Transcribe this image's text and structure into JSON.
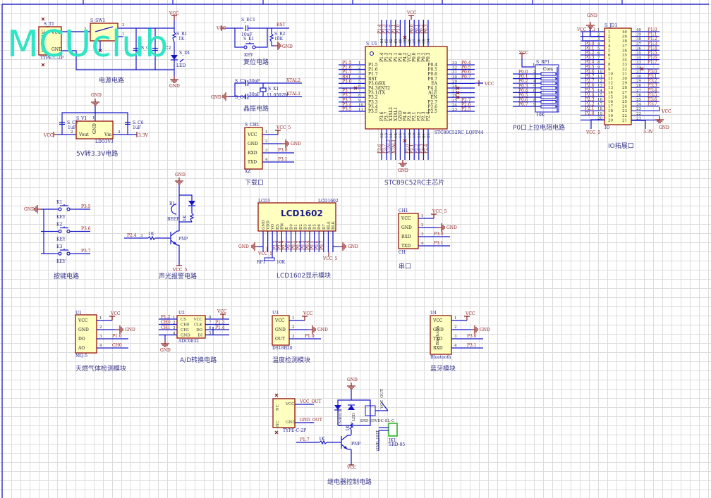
{
  "watermark": "MCUclub",
  "colors": {
    "wire": "#1414c8",
    "net": "#8b1a1a",
    "body_fill": "#ffffc0",
    "body_stroke": "#8b0000",
    "title": "#3a3a8c",
    "watermark": "#2ee6c4"
  },
  "power": {
    "title": "电源电路",
    "t1": "S_T1",
    "t1_type": "TYPE-C-2P",
    "t1_pins": [
      "NC",
      "VCC",
      "NC",
      "GND"
    ],
    "sw": "S_SW1",
    "sw_pins": [
      "2",
      "3",
      "1"
    ],
    "c1": "S_C",
    "c2": "C2",
    "r1": "S_R1",
    "r1_val": "1K",
    "d1": "S_D1",
    "led": "LED",
    "vcc": "VCC",
    "gnd": "GND"
  },
  "reset": {
    "title": "复位电路",
    "vcc": "VCC",
    "ec1": "S_EC1",
    "ec1_val": "10uF",
    "rst": "RST",
    "r2": "S_R2",
    "r2_val": "10K",
    "gnd": "GND",
    "k1": "S_K1",
    "key": "KEY"
  },
  "crystal": {
    "title": "晶振电路",
    "c3": "S_C3",
    "c4": "S_C4",
    "cap_val": "30pF",
    "x1": "S_X1",
    "x1_val": "11.0592M",
    "xtal2": "XTAL2",
    "xtal1": "XTAL1",
    "gnd": "GND"
  },
  "ldo": {
    "title": "5V转3.3V电路",
    "gnd": "GND",
    "v1": "S_V1",
    "v1_type": "LDO3V3",
    "pin_vout": "Vout",
    "pin_gnd": "GND",
    "pin_vin": "Vin",
    "pin_nums": [
      "2",
      "1",
      "3"
    ],
    "c5": "S_C5",
    "c6": "S_C6",
    "cap_val": "1uF",
    "vcc": "VCC",
    "v33": "3.3V"
  },
  "download": {
    "title": "下载口",
    "ref": "S_CH1",
    "type": "XZ",
    "pins": [
      {
        "num": "1",
        "name": "VCC",
        "net": "VCC_5"
      },
      {
        "num": "2",
        "name": "GND",
        "net": "GND"
      },
      {
        "num": "3",
        "name": "RXD",
        "net": "P3.0"
      },
      {
        "num": "4",
        "name": "TXD",
        "net": "P3.1"
      }
    ]
  },
  "mcu": {
    "title": "STC89C52RC主芯片",
    "ref": "S_U1",
    "type": "STC89C52RC_LQFP44",
    "vcc": "VCC",
    "gnd": "GND",
    "ea_net": "VCC",
    "left": [
      {
        "num": "1",
        "name": "P1.5",
        "net": "P1.5"
      },
      {
        "num": "2",
        "name": "P1.6",
        "net": "P1.6"
      },
      {
        "num": "3",
        "name": "P1.7",
        "net": "P1.7"
      },
      {
        "num": "4",
        "name": "RST",
        "net": "RST"
      },
      {
        "num": "5",
        "name": "P3.0/RX",
        "net": "P3.0"
      },
      {
        "num": "6",
        "name": "P4.3/INT2",
        "net": ""
      },
      {
        "num": "7",
        "name": "P3.1/TX",
        "net": "P3.1"
      },
      {
        "num": "8",
        "name": "P3.2",
        "net": "P3.2"
      },
      {
        "num": "9",
        "name": "P3.3",
        "net": "P3.3"
      },
      {
        "num": "10",
        "name": "P3.4",
        "net": "P3.4"
      },
      {
        "num": "11",
        "name": "P3.5",
        "net": "P3.5"
      }
    ],
    "right": [
      {
        "num": "33",
        "name": "P0.4",
        "net": "P0.4"
      },
      {
        "num": "32",
        "name": "P0.5",
        "net": "P0.5"
      },
      {
        "num": "31",
        "name": "P0.6",
        "net": "P0.6"
      },
      {
        "num": "30",
        "name": "P0.7",
        "net": "P0.7"
      },
      {
        "num": "29",
        "name": "EA",
        "net": ""
      },
      {
        "num": "28",
        "name": "P4.1",
        "net": ""
      },
      {
        "num": "27",
        "name": "ALE",
        "net": ""
      },
      {
        "num": "26",
        "name": "EN",
        "net": ""
      },
      {
        "num": "25",
        "name": "P2.7",
        "net": "P2.7"
      },
      {
        "num": "24",
        "name": "P2.6",
        "net": "P2.6"
      },
      {
        "num": "23",
        "name": "P2.5",
        "net": "P2.5"
      }
    ],
    "top": [
      {
        "num": "44",
        "name": "P1.4",
        "net": "P1.4"
      },
      {
        "num": "43",
        "name": "P1.3",
        "net": "P1.3"
      },
      {
        "num": "42",
        "name": "P1.2",
        "net": "P1.2"
      },
      {
        "num": "41",
        "name": "P1.1",
        "net": "P1.1"
      },
      {
        "num": "40",
        "name": "P1.0",
        "net": "P1.0"
      },
      {
        "num": "39",
        "name": "P4.2",
        "net": ""
      },
      {
        "num": "38",
        "name": "VCC",
        "net": ""
      },
      {
        "num": "37",
        "name": "P0.0",
        "net": "P0.0"
      },
      {
        "num": "36",
        "name": "P0.1",
        "net": "P0.1"
      },
      {
        "num": "35",
        "name": "P0.2",
        "net": "P0.2"
      },
      {
        "num": "34",
        "name": "P0.3",
        "net": "P0.3"
      }
    ],
    "bottom": [
      {
        "num": "12",
        "name": "P3.6",
        "net": "P3.6"
      },
      {
        "num": "13",
        "name": "P3.7",
        "net": "P3.7"
      },
      {
        "num": "14",
        "name": "XTAL2",
        "net": "XTAL2"
      },
      {
        "num": "15",
        "name": "XTAL1",
        "net": "XTAL1"
      },
      {
        "num": "16",
        "name": "GND",
        "net": ""
      },
      {
        "num": "17",
        "name": "P4.0",
        "net": ""
      },
      {
        "num": "18",
        "name": "P2.0",
        "net": "P2.0"
      },
      {
        "num": "19",
        "name": "P2.1",
        "net": "P2.1"
      },
      {
        "num": "20",
        "name": "P2.2",
        "net": "P2.2"
      },
      {
        "num": "21",
        "name": "P2.3",
        "net": "P2.3"
      },
      {
        "num": "22",
        "name": "P2.4",
        "net": "P2.4"
      }
    ]
  },
  "pullup": {
    "title": "P0口上拉电阻电路",
    "ref": "S_RP1",
    "value": "10K",
    "com": "Com",
    "vcc": "VCC",
    "pins": [
      {
        "num": "2",
        "net": "P0.0"
      },
      {
        "num": "3",
        "net": "P0.1"
      },
      {
        "num": "4",
        "net": "P0.2"
      },
      {
        "num": "5",
        "net": "P0.3"
      },
      {
        "num": "6",
        "net": "P0.4"
      },
      {
        "num": "7",
        "net": "P0.5"
      },
      {
        "num": "8",
        "net": "P0.6"
      },
      {
        "num": "9",
        "net": "P0.7"
      }
    ],
    "com_pin": "1"
  },
  "io": {
    "title": "IO拓展口",
    "ref": "S_JD1",
    "type": "IO",
    "gnd": "GND",
    "vcc33": "VCC_3.3",
    "vcc5": "VCC_5",
    "vcc": "VCC",
    "gnd2": "GND",
    "v33": "3.3V",
    "left": [
      {
        "num": "1",
        "net": ""
      },
      {
        "num": "2",
        "net": ""
      },
      {
        "num": "3",
        "net": ""
      },
      {
        "num": "4",
        "net": "P0.0"
      },
      {
        "num": "5",
        "net": "P0.1"
      },
      {
        "num": "6",
        "net": "P0.2"
      },
      {
        "num": "7",
        "net": "P0.3"
      },
      {
        "num": "8",
        "net": "P0.4"
      },
      {
        "num": "9",
        "net": "P0.5"
      },
      {
        "num": "10",
        "net": "P0.6"
      },
      {
        "num": "11",
        "net": "P0.7"
      },
      {
        "num": "12",
        "net": "P2.7"
      },
      {
        "num": "13",
        "net": "P2.6"
      },
      {
        "num": "14",
        "net": "P2.5"
      },
      {
        "num": "15",
        "net": "P2.4"
      },
      {
        "num": "16",
        "net": "P2.3"
      },
      {
        "num": "17",
        "net": "P2.2"
      },
      {
        "num": "18",
        "net": "P2.1"
      },
      {
        "num": "19",
        "net": "P2.0"
      },
      {
        "num": "20",
        "net": ""
      }
    ],
    "right": [
      {
        "num": "40",
        "net": "P1.0"
      },
      {
        "num": "39",
        "net": "P1.1"
      },
      {
        "num": "38",
        "net": "P1.2"
      },
      {
        "num": "37",
        "net": "P1.3"
      },
      {
        "num": "36",
        "net": "P1.4"
      },
      {
        "num": "35",
        "net": "P1.5"
      },
      {
        "num": "34",
        "net": "P1.6"
      },
      {
        "num": "33",
        "net": "P1.7"
      },
      {
        "num": "32",
        "net": ""
      },
      {
        "num": "31",
        "net": "P3.0"
      },
      {
        "num": "30",
        "net": "P3.1"
      },
      {
        "num": "29",
        "net": "P3.2"
      },
      {
        "num": "28",
        "net": "P3.3"
      },
      {
        "num": "27",
        "net": "P3.4"
      },
      {
        "num": "26",
        "net": "P3.5"
      },
      {
        "num": "25",
        "net": "P3.6"
      },
      {
        "num": "24",
        "net": "P3.7"
      },
      {
        "num": "23",
        "net": ""
      },
      {
        "num": "22",
        "net": ""
      },
      {
        "num": "21",
        "net": ""
      }
    ]
  },
  "keys": {
    "title": "按键电路",
    "gnd": "GND",
    "items": [
      {
        "ref": "K1",
        "type": "KEY",
        "net": "P3.5"
      },
      {
        "ref": "K2",
        "type": "KEY",
        "net": "P3.6"
      },
      {
        "ref": "K3",
        "type": "KEY",
        "net": "P3.7"
      }
    ]
  },
  "alarm": {
    "title": "声光报警电路",
    "gnd": "GND",
    "b1": "B1",
    "b1_type": "BEEP",
    "r_base": "1K",
    "r_led": "1K",
    "net": "P2.4",
    "pin": "3",
    "q": "PNP",
    "vcc": "VCC_5"
  },
  "lcd": {
    "title": "LCD1602显示模块",
    "ref": "LCD1",
    "type": "LCD1602",
    "label": "LCD1602",
    "pins": [
      "GND",
      "VDD",
      "VO",
      "RS",
      "RW",
      "E",
      "D0",
      "D1",
      "D2",
      "D3",
      "D4",
      "D5",
      "D6",
      "D7",
      "BLA",
      "BLK"
    ],
    "nets": [
      "",
      "VCC_5",
      "",
      "P2.5",
      "P2.6",
      "P2.7",
      "P0.0",
      "P0.1",
      "P0.2",
      "P0.3",
      "P0.4",
      "P0.5",
      "P0.6",
      "P0.7",
      "VCC_5",
      ""
    ],
    "rp": "RP1",
    "rp_val": "10K",
    "gnd": "GND",
    "gnd2": "GND"
  },
  "serial": {
    "title": "串口",
    "ref": "CH1",
    "type": "CH",
    "pins": [
      {
        "num": "1",
        "name": "VCC",
        "net": "VCC_5"
      },
      {
        "num": "2",
        "name": "GND",
        "net": "GND"
      },
      {
        "num": "3",
        "name": "RXD",
        "net": "P3.0"
      },
      {
        "num": "4",
        "name": "TXD",
        "net": "P3.1"
      }
    ]
  },
  "gas": {
    "title": "天燃气体检测模块",
    "ref": "U1",
    "type": "MQ-5",
    "pins": [
      {
        "num": "1",
        "name": "VCC",
        "net": "VCC"
      },
      {
        "num": "2",
        "name": "GND",
        "net": "GND"
      },
      {
        "num": "3",
        "name": "DO",
        "net": "P1.0"
      },
      {
        "num": "4",
        "name": "AO",
        "net": "CH0"
      }
    ]
  },
  "adc": {
    "title": "A/D转换电路",
    "ref": "U2",
    "type": "ADC0832",
    "gnd": "GND",
    "vcc": "VCC",
    "left": [
      {
        "num": "1",
        "name": "CS",
        "net": "P1.2"
      },
      {
        "num": "2",
        "name": "CH0",
        "net": "CH0"
      },
      {
        "num": "3",
        "name": "CH1",
        "net": "CH1"
      },
      {
        "num": "4",
        "name": "GND",
        "net": ""
      }
    ],
    "right": [
      {
        "num": "8",
        "name": "VCC",
        "net": ""
      },
      {
        "num": "7",
        "name": "CLK",
        "net": "P1.3"
      },
      {
        "num": "6",
        "name": "DO",
        "net": "P1.4"
      },
      {
        "num": "5",
        "name": "DI",
        "net": ""
      }
    ]
  },
  "temp": {
    "title": "温度检测模块",
    "ref": "U3",
    "type": "DS18B20",
    "pins": [
      {
        "num": "1",
        "name": "VCC",
        "net": "VCC"
      },
      {
        "num": "2",
        "name": "GND",
        "net": "GND"
      },
      {
        "num": "3",
        "name": "OUT",
        "net": "P1.0"
      }
    ]
  },
  "bt": {
    "title": "蓝牙模块",
    "ref": "U4",
    "type": "Bluetooth",
    "body_label": "Bluetooth",
    "pins": [
      {
        "num": "1",
        "name": "VCC",
        "net": "VCC"
      },
      {
        "num": "2",
        "name": "GND",
        "net": "GND"
      },
      {
        "num": "3",
        "name": "TXD",
        "net": "P3.0"
      },
      {
        "num": "4",
        "name": "RXD",
        "net": "P3.1"
      }
    ]
  },
  "relay": {
    "title": "继电器控制电路",
    "conn_type": "TYPE-C-2P",
    "conn_pins": [
      "NC",
      "VCC",
      "NC",
      "GND"
    ],
    "vcc_out": "VCC_OUT",
    "gnd_out": "GND_OUT",
    "gnd": "GND",
    "diode": "1N4007",
    "led": "LED",
    "r_led": "1K",
    "r_base": "1K",
    "relay": "SRD-05VDC-SL-C",
    "jk": "JK1",
    "jk_type": "SRD-05",
    "net": "P1.7",
    "q": "PNP",
    "vcc": "VCC",
    "vcc_out2": "VCC_OUT",
    "gnd_out2": "GND_OUT"
  }
}
